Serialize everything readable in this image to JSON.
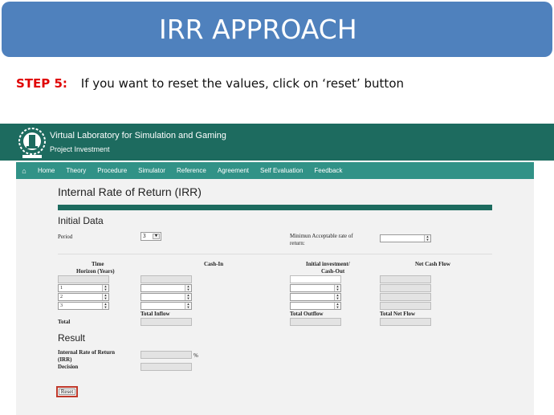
{
  "slide": {
    "title": "IRR APPROACH",
    "step_label": "STEP 5:",
    "step_text": "If you want to reset the values, click on ‘reset’ button"
  },
  "app": {
    "title": "Virtual Laboratory for Simulation and Gaming",
    "subtitle": "Project Investment",
    "nav": [
      "Home",
      "Theory",
      "Procedure",
      "Simulator",
      "Reference",
      "Agreement",
      "Self Evaluation",
      "Feedback"
    ],
    "page_title": "Internal Rate of Return (IRR)",
    "initial_data": {
      "heading": "Initial Data",
      "period_label": "Period",
      "period_value": "3",
      "marr_label_1": "Minimun Acceptable rate of",
      "marr_label_2": "return:"
    },
    "table": {
      "col_time_1": "Time",
      "col_time_2": "Horizon (Years)",
      "col_cashin": "Cash-In",
      "col_initial_1": "Initial investment/",
      "col_initial_2": "Cash-Out",
      "col_net": "Net Cash Flow",
      "rows": [
        "1",
        "2",
        "3"
      ],
      "total_inflow": "Total Inflow",
      "total_outflow": "Total Outflow",
      "total_net": "Total Net Flow",
      "total_label": "Total"
    },
    "result": {
      "heading": "Result",
      "irr_label_1": "Internal Rate of Return",
      "irr_label_2": "(IRR)",
      "percent": "%",
      "decision_label": "Decision"
    },
    "reset_label": "Reset"
  },
  "colors": {
    "slide_header": "#4f81bd",
    "step_label": "#e00000",
    "app_header": "#1d6b5f",
    "navbar": "#319287",
    "reset_highlight": "#c0392b"
  }
}
